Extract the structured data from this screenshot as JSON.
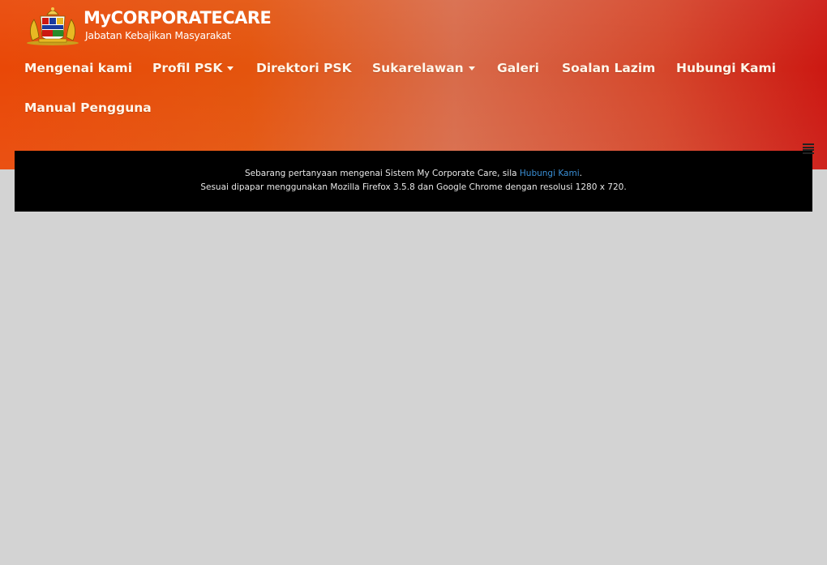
{
  "logo": {
    "title": "MyCORPORATECARE",
    "subtitle": "Jabatan Kebajikan Masyarakat",
    "emblem_icon": "malaysia-coat-of-arms-icon"
  },
  "nav": {
    "items": [
      {
        "label": "Mengenai kami",
        "dropdown": false
      },
      {
        "label": "Profil PSK",
        "dropdown": true
      },
      {
        "label": "Direktori PSK",
        "dropdown": false
      },
      {
        "label": "Sukarelawan",
        "dropdown": true
      },
      {
        "label": "Galeri",
        "dropdown": false
      },
      {
        "label": "Soalan Lazim",
        "dropdown": false
      },
      {
        "label": "Hubungi Kami",
        "dropdown": false
      },
      {
        "label": "Manual Pengguna",
        "dropdown": false
      }
    ],
    "toggle_icon": "menu-toggle-icon"
  },
  "footer": {
    "line1_prefix": "Sebarang pertanyaan mengenai Sistem My Corporate Care, sila ",
    "line1_link": "Hubungi Kami",
    "line1_suffix": ".",
    "line2": "Sesuai dipapar menggunakan Mozilla Firefox 3.5.8 dan Google Chrome dengan resolusi 1280 x 720."
  },
  "colors": {
    "header_start": "#e94807",
    "header_end": "#cc1812",
    "link": "#3a8fd6",
    "page_bg": "#d3d3d3"
  }
}
